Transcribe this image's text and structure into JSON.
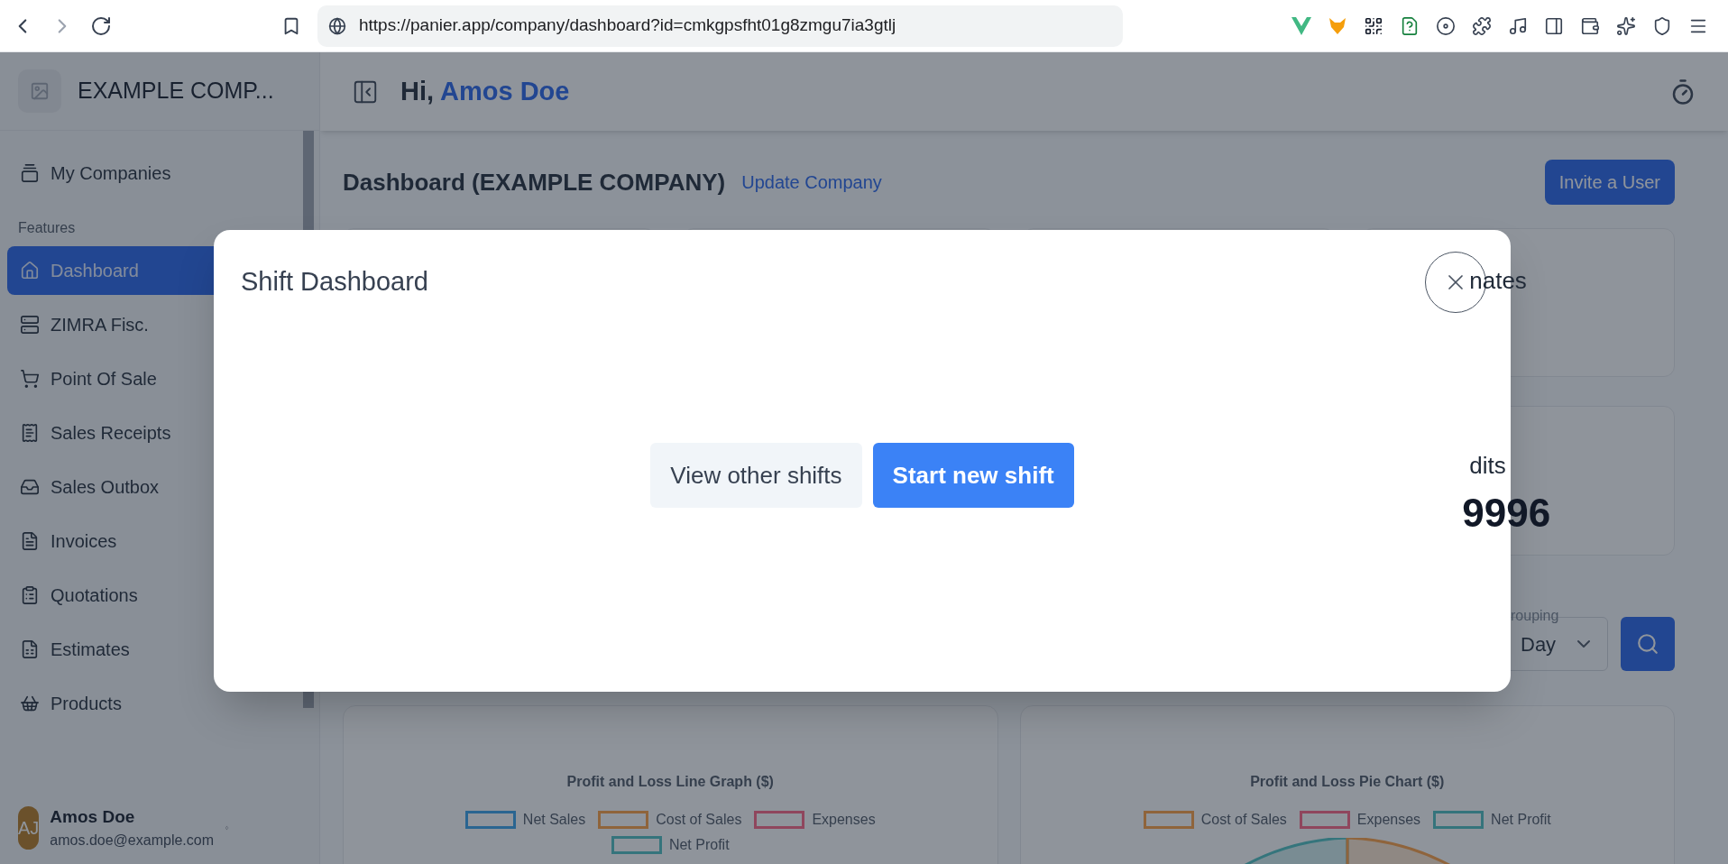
{
  "browser": {
    "url": "https://panier.app/company/dashboard?id=cmkgpsfht01g8zmgu7ia3gtlj"
  },
  "sidebar": {
    "company": "EXAMPLE COMP...",
    "top_items": [
      {
        "label": "My Companies",
        "selected": false
      }
    ],
    "section": "Features",
    "items": [
      {
        "label": "Dashboard",
        "selected": true
      },
      {
        "label": "ZIMRA Fisc.",
        "selected": false
      },
      {
        "label": "Point Of Sale",
        "selected": false
      },
      {
        "label": "Sales Receipts",
        "selected": false
      },
      {
        "label": "Sales Outbox",
        "selected": false
      },
      {
        "label": "Invoices",
        "selected": false
      },
      {
        "label": "Quotations",
        "selected": false
      },
      {
        "label": "Estimates",
        "selected": false
      },
      {
        "label": "Products",
        "selected": false
      }
    ],
    "user": {
      "initials": "AJ",
      "name": "Amos Doe",
      "email": "amos.doe@example.com"
    }
  },
  "header": {
    "greeting": "Hi,",
    "name": "Amos Doe"
  },
  "page": {
    "title": "Dashboard (EXAMPLE COMPANY)",
    "link": "Update Company",
    "invite_button": "Invite a User"
  },
  "stat_cards": [
    {
      "title": "nates"
    },
    {
      "title": "dits",
      "value": "9996"
    }
  ],
  "grouping": {
    "label": "rouping",
    "value": "Day"
  },
  "charts": [
    {
      "title": "Profit and Loss Line Graph ($)",
      "legend": [
        {
          "label": "Net Sales",
          "color": "#2a6591"
        },
        {
          "label": "Cost of Sales",
          "color": "#8f643b"
        },
        {
          "label": "Expenses",
          "color": "#8f465d"
        },
        {
          "label": "Net Profit",
          "color": "#35747c"
        }
      ]
    },
    {
      "title": "Profit and Loss Pie Chart ($)",
      "legend": [
        {
          "label": "Cost of Sales",
          "color": "#8f643b"
        },
        {
          "label": "Expenses",
          "color": "#8f465d"
        },
        {
          "label": "Net Profit",
          "color": "#35747c"
        }
      ]
    }
  ],
  "modal": {
    "title": "Shift Dashboard",
    "buttons": [
      {
        "label": "View other shifts",
        "kind": "secondary"
      },
      {
        "label": "Start new shift",
        "kind": "primary"
      }
    ]
  }
}
